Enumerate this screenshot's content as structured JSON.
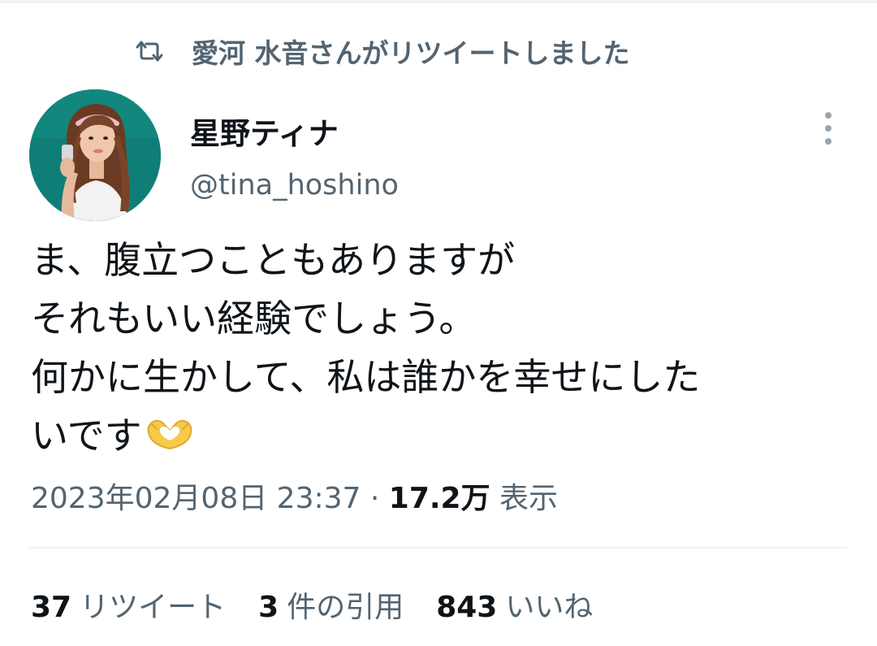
{
  "social_context": {
    "text": "愛河 水音さんがリツイートしました",
    "icon": "retweet-icon"
  },
  "author": {
    "display_name": "星野ティナ",
    "handle": "@tina_hoshino",
    "avatar": "profile-photo"
  },
  "tweet": {
    "lines": [
      "ま、腹立つこともありますが",
      "それもいい経験でしょう。",
      "何かに生かして、私は誰かを幸せにした",
      "いです"
    ],
    "emoji": "heart-hands-emoji"
  },
  "meta": {
    "timestamp": "2023年02月08日 23:37",
    "separator": " · ",
    "views_count": "17.2万",
    "views_label": " 表示"
  },
  "stats": {
    "retweets": {
      "count": "37",
      "label": "リツイート"
    },
    "quotes": {
      "count": "3",
      "label": "件の引用"
    },
    "likes": {
      "count": "843",
      "label": "いいね"
    }
  },
  "colors": {
    "text_primary": "#0f1419",
    "text_secondary": "#536471",
    "divider": "#eff3f4",
    "avatar_bg": "#0f7e76",
    "emoji": "#f7c948"
  }
}
